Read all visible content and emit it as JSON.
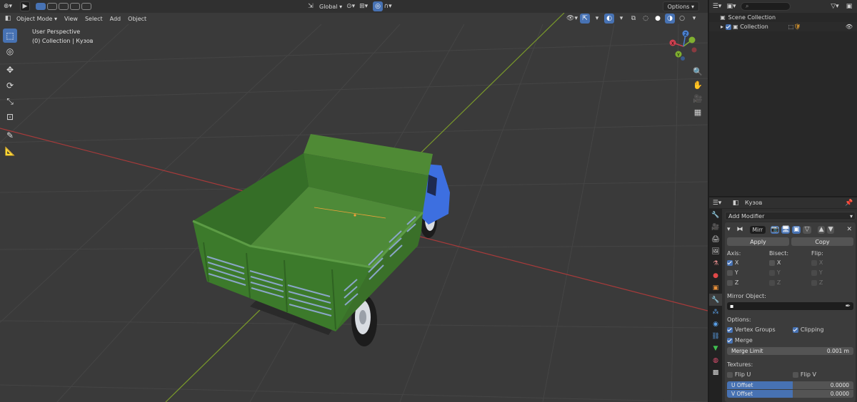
{
  "viewport": {
    "header": {
      "mode": "Object Mode",
      "menus": [
        "View",
        "Select",
        "Add",
        "Object"
      ],
      "transform_orientation": "Global",
      "options": "Options"
    },
    "overlay": {
      "perspective": "User Perspective",
      "collection_info": "(0) Collection | Кузов"
    },
    "gizmo_axes": [
      "X",
      "Y",
      "Z"
    ]
  },
  "outliner": {
    "scene_collection": "Scene Collection",
    "collection": "Collection"
  },
  "properties": {
    "object_name": "Кузов",
    "add_modifier": "Add Modifier",
    "modifier": {
      "name": "Mirr",
      "apply": "Apply",
      "copy": "Copy",
      "axis_label": "Axis:",
      "bisect_label": "Bisect:",
      "flip_label": "Flip:",
      "axes": [
        "X",
        "Y",
        "Z"
      ],
      "axis_checked": [
        true,
        false,
        false
      ],
      "mirror_object_label": "Mirror Object:",
      "options_label": "Options:",
      "vertex_groups": "Vertex Groups",
      "clipping": "Clipping",
      "merge": "Merge",
      "merge_limit_label": "Merge Limit",
      "merge_limit_value": "0.001 m",
      "textures_label": "Textures:",
      "flip_u": "Flip U",
      "flip_v": "Flip V",
      "u_offset_label": "U Offset",
      "u_offset_value": "0.0000",
      "v_offset_label": "V Offset",
      "v_offset_value": "0.0000"
    }
  },
  "colors": {
    "accent": "#4772b3",
    "truck_body": "#3e7a2e",
    "truck_cab": "#3d6fe0",
    "x_axis_line": "#a83a3a",
    "y_axis_line": "#7a9a2a"
  }
}
